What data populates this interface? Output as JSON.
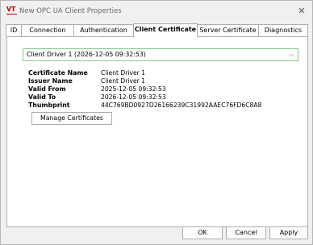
{
  "window": {
    "logo_text": "VT",
    "title": "New OPC UA Client Properties",
    "close_glyph": "✕"
  },
  "tabs": [
    {
      "label": "ID",
      "active": false
    },
    {
      "label": "Connection",
      "active": false
    },
    {
      "label": "Authentication",
      "active": false
    },
    {
      "label": "Client Certificate",
      "active": true
    },
    {
      "label": "Server Certificate",
      "active": false
    },
    {
      "label": "Diagnostics",
      "active": false
    }
  ],
  "client_certificate": {
    "selected": "Client Driver 1  (2026-12-05 09:32:53)",
    "fields": [
      {
        "label": "Certificate Name",
        "value": "Client Driver 1"
      },
      {
        "label": "Issuer Name",
        "value": "Client Driver 1"
      },
      {
        "label": "Valid From",
        "value": "2025-12-05 09:32:53"
      },
      {
        "label": "Valid To",
        "value": "2026-12-05 09:32:53"
      },
      {
        "label": "Thumbprint",
        "value": "44C769BD0927D26166239C31992AAEC76FD6C8A8"
      }
    ],
    "manage_label": "Manage Certificates"
  },
  "footer": {
    "ok_label": "OK",
    "cancel_label": "Cancel",
    "apply_label": "Apply"
  },
  "colors": {
    "logo": "#b30000",
    "combo_border_focus": "#7fc97f"
  },
  "icons": {
    "close": "close-icon",
    "dropdown": "chevron-down-icon"
  }
}
